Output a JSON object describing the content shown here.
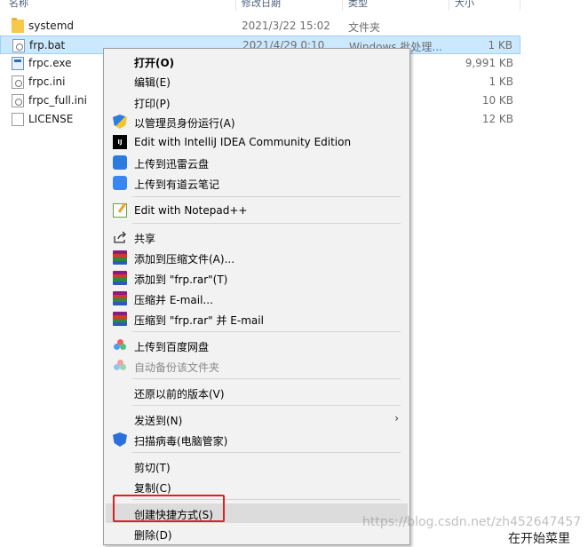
{
  "header": {
    "name_label": "名称",
    "date_label": "修改日期",
    "type_label": "类型",
    "size_label": "大小"
  },
  "files": [
    {
      "name": "systemd",
      "date": "2021/3/22 15:02",
      "type": "文件夹",
      "size": "",
      "icon": "folder-icon"
    },
    {
      "name": "frp.bat",
      "date": "2021/4/29 0:10",
      "type": "Windows 批处理...",
      "size": "1 KB",
      "icon": "batch-file-icon"
    },
    {
      "name": "frpc.exe",
      "date": "",
      "type": "",
      "size": "9,991 KB",
      "icon": "exe-file-icon"
    },
    {
      "name": "frpc.ini",
      "date": "",
      "type": "",
      "size": "1 KB",
      "icon": "ini-file-icon"
    },
    {
      "name": "frpc_full.ini",
      "date": "",
      "type": "",
      "size": "10 KB",
      "icon": "ini-file-icon"
    },
    {
      "name": "LICENSE",
      "date": "",
      "type": "",
      "size": "12 KB",
      "icon": "file-icon"
    }
  ],
  "menu": {
    "open": "打开(O)",
    "edit": "编辑(E)",
    "print": "打印(P)",
    "run_as_admin": "以管理员身份运行(A)",
    "edit_intellij": "Edit with IntelliJ IDEA Community Edition",
    "upload_xunlei": "上传到迅雷云盘",
    "upload_youdao": "上传到有道云笔记",
    "edit_notepad": "Edit with Notepad++",
    "share": "共享",
    "add_to_archive": "添加到压缩文件(A)...",
    "add_to_frp_rar": "添加到 \"frp.rar\"(T)",
    "compress_email": "压缩并 E-mail...",
    "compress_frp_email": "压缩到 \"frp.rar\" 并 E-mail",
    "upload_baidu": "上传到百度网盘",
    "auto_backup": "自动备份该文件夹",
    "restore_versions": "还原以前的版本(V)",
    "send_to": "发送到(N)",
    "scan_virus": "扫描病毒(电脑管家)",
    "cut": "剪切(T)",
    "copy": "复制(C)",
    "create_shortcut": "创建快捷方式(S)",
    "delete": "删除(D)"
  },
  "icons": {
    "intellij_glyph": "IJ",
    "send_to_arrow": "›"
  },
  "watermark": "https://blog.csdn.net/zh452647457",
  "bottom_partial_text": "在开始菜里"
}
